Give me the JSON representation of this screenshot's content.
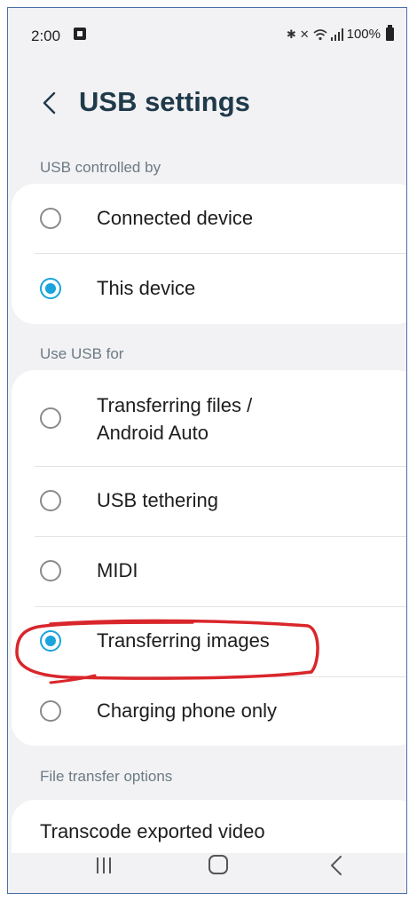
{
  "status_bar": {
    "time": "2:00",
    "battery": "100%",
    "icons": [
      "image-icon",
      "bluetooth-icon",
      "mute-icon",
      "wifi-icon",
      "signal-icon",
      "battery-icon"
    ]
  },
  "header": {
    "title": "USB settings",
    "back_icon": "chevron-left-icon"
  },
  "usb_controlled_by": {
    "label": "USB controlled by",
    "options": [
      {
        "label": "Connected device",
        "selected": false
      },
      {
        "label": "This device",
        "selected": true
      }
    ]
  },
  "use_usb_for": {
    "label": "Use USB for",
    "options": [
      {
        "label": "Transferring files /",
        "label2": "Android Auto",
        "selected": false
      },
      {
        "label": "USB tethering",
        "selected": false
      },
      {
        "label": "MIDI",
        "selected": false
      },
      {
        "label": "Transferring images",
        "selected": true
      },
      {
        "label": "Charging phone only",
        "selected": false
      }
    ]
  },
  "file_transfer_options": {
    "label": "File transfer options",
    "item": "Transcode exported video"
  },
  "nav_bar": {
    "icons": [
      "recent-apps-icon",
      "home-icon",
      "back-icon"
    ]
  },
  "colors": {
    "accent": "#1aa3dc",
    "annotation": "#d9262b",
    "title": "#1f3a4a",
    "section_label": "#6b7a85"
  }
}
